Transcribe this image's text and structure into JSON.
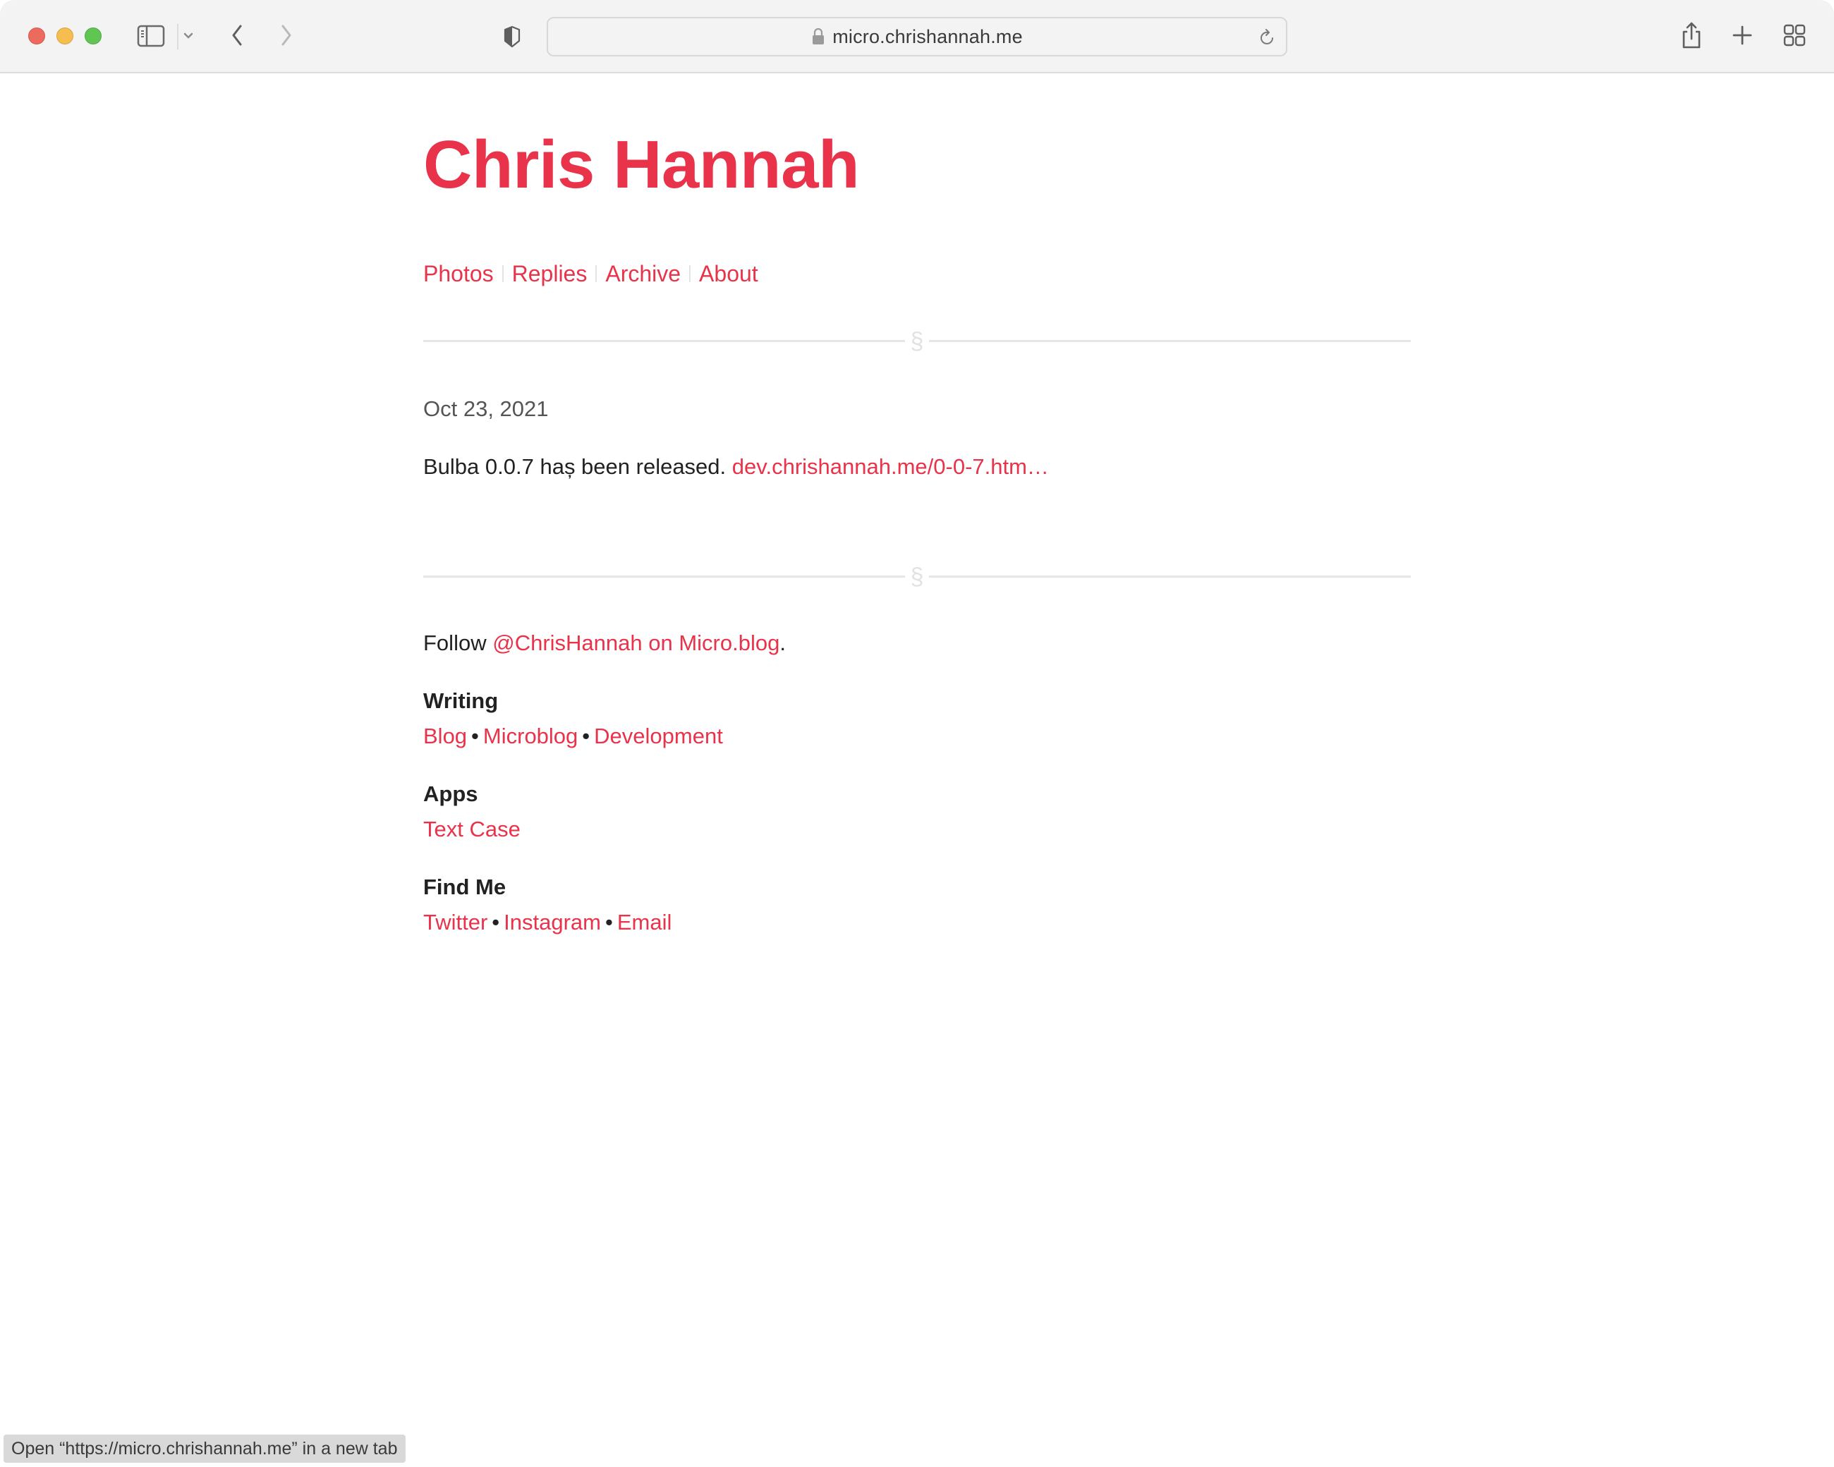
{
  "browser": {
    "url": "micro.chrishannah.me",
    "icons": {
      "sidebar": "sidebar-icon",
      "sidebar_menu": "chevron-down-icon",
      "back": "chevron-left-icon",
      "forward": "chevron-right-icon",
      "privacy": "shield-icon",
      "lock": "lock-icon",
      "reload": "reload-icon",
      "share": "share-icon",
      "new_tab": "plus-icon",
      "tab_overview": "grid-icon"
    }
  },
  "theme": {
    "accent": "#e8334a",
    "text": "#222222",
    "muted": "#555555",
    "rule": "#e6e6e6"
  },
  "site": {
    "title": "Chris Hannah",
    "nav": [
      {
        "label": "Photos"
      },
      {
        "label": "Replies"
      },
      {
        "label": "Archive"
      },
      {
        "label": "About"
      }
    ],
    "separator_glyph": "§"
  },
  "post": {
    "date": "Oct 23, 2021",
    "text": "Bulba 0.0.7 haș been released.",
    "link": "dev.chrishannah.me/0-0-7.htm…"
  },
  "footer": {
    "follow_prefix": "Follow",
    "follow_link": "@ChrisHannah on Micro.blog",
    "follow_suffix": ".",
    "sections": [
      {
        "heading": "Writing",
        "links": [
          "Blog",
          "Microblog",
          "Development"
        ]
      },
      {
        "heading": "Apps",
        "links": [
          "Text Case"
        ]
      },
      {
        "heading": "Find Me",
        "links": [
          "Twitter",
          "Instagram",
          "Email"
        ]
      }
    ],
    "bullet": "•"
  },
  "status_bar": {
    "text": "Open “https://micro.chrishannah.me” in a new tab"
  }
}
